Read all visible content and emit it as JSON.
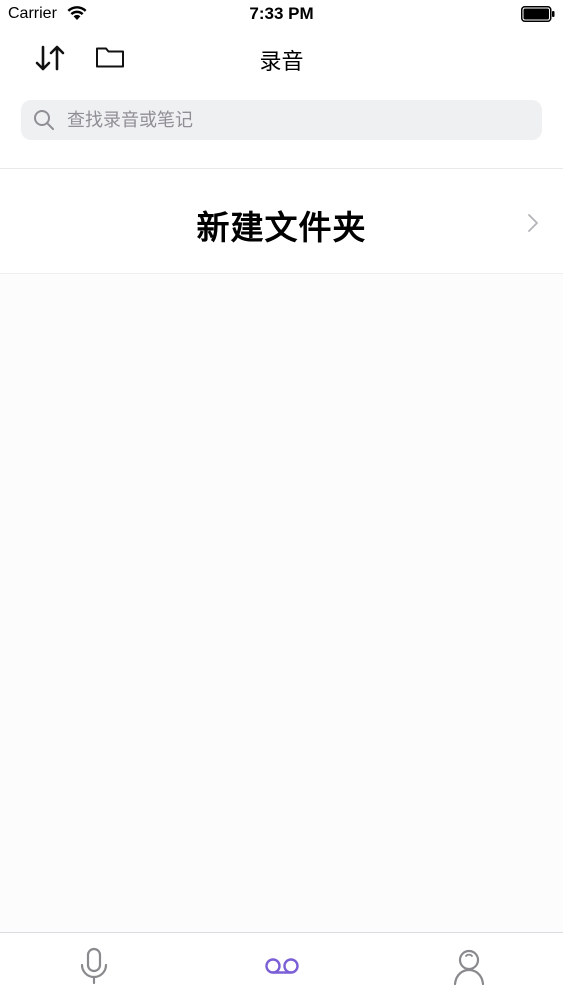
{
  "status_bar": {
    "carrier": "Carrier",
    "time": "7:33 PM",
    "wifi_icon": "wifi-icon",
    "battery_icon": "battery-full-icon"
  },
  "nav": {
    "title": "录音",
    "sort_icon": "sort-arrows-icon",
    "folder_icon": "folder-icon"
  },
  "search": {
    "placeholder": "查找录音或笔记",
    "value": ""
  },
  "list": {
    "new_folder_label": "新建文件夹"
  },
  "tabs": [
    {
      "name": "record",
      "icon": "microphone-icon",
      "active": false
    },
    {
      "name": "recordings",
      "icon": "voicemail-icon",
      "active": true
    },
    {
      "name": "profile",
      "icon": "person-icon",
      "active": false
    }
  ],
  "colors": {
    "accent": "#7b5fd6",
    "inactive_tab": "#8a8a8e",
    "search_bg": "#eff0f2"
  }
}
